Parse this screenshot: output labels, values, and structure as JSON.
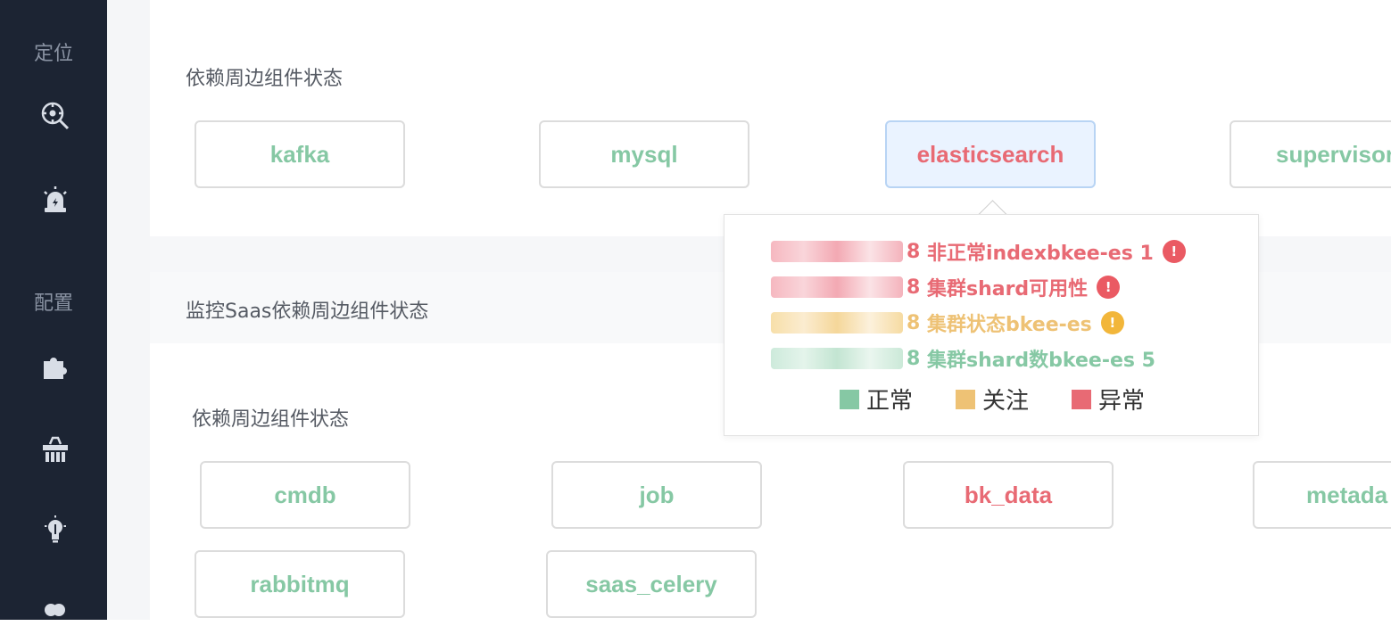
{
  "sidebar": {
    "groups": [
      {
        "title": "定位",
        "icons": [
          "search-locate-icon",
          "alarm-icon"
        ]
      },
      {
        "title": "配置",
        "icons": [
          "plugin-icon",
          "collect-icon",
          "bulb-icon",
          "toggle-icon"
        ]
      }
    ]
  },
  "section1": {
    "title": "依赖周边组件状态",
    "components": [
      {
        "name": "kafka",
        "status": "normal"
      },
      {
        "name": "mysql",
        "status": "normal"
      },
      {
        "name": "elasticsearch",
        "status": "error"
      },
      {
        "name": "supervisor",
        "status": "normal"
      }
    ]
  },
  "section2": {
    "header": "监控Saas依赖周边组件状态",
    "title": "依赖周边组件状态",
    "components": [
      {
        "name": "cmdb",
        "status": "normal"
      },
      {
        "name": "job",
        "status": "normal"
      },
      {
        "name": "bk_data",
        "status": "error"
      },
      {
        "name": "metada",
        "status": "normal"
      },
      {
        "name": "rabbitmq",
        "status": "normal"
      },
      {
        "name": "saas_celery",
        "status": "normal"
      }
    ]
  },
  "popup": {
    "rows": [
      {
        "prefix": "8",
        "text": "非正常indexbkee-es 1",
        "level": "error",
        "badge": "!"
      },
      {
        "prefix": "8",
        "text": "集群shard可用性",
        "level": "error",
        "badge": "!"
      },
      {
        "prefix": "8",
        "text": "集群状态bkee-es",
        "level": "warn",
        "badge": "!"
      },
      {
        "prefix": "8",
        "text": "集群shard数bkee-es 5",
        "level": "ok",
        "badge": ""
      }
    ],
    "legend": [
      {
        "label": "正常",
        "color": "#86c8a4"
      },
      {
        "label": "关注",
        "color": "#eec275"
      },
      {
        "label": "异常",
        "color": "#e86a74"
      }
    ]
  }
}
